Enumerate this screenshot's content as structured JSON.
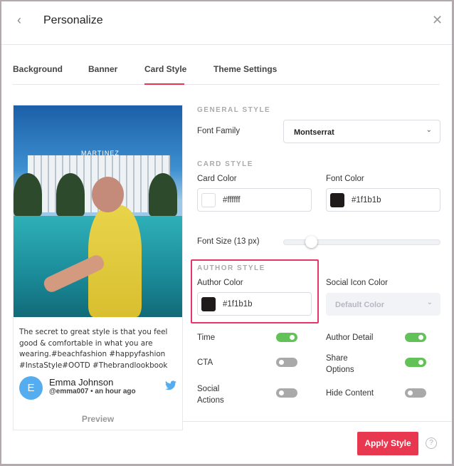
{
  "header": {
    "title": "Personalize",
    "back_icon": "chevron-left",
    "close_icon": "close"
  },
  "tabs": [
    {
      "label": "Background"
    },
    {
      "label": "Banner"
    },
    {
      "label": "Card Style",
      "active": true
    },
    {
      "label": "Theme Settings"
    }
  ],
  "accent_color": "#e8344e",
  "preview": {
    "image_sign": "MARTINEZ",
    "text": "The secret to great style is that you feel good & comfortable in what you are wearing.#beachfashion #happyfashion #InstaStyle#OOTD #Thebrandlookbook",
    "avatar_letter": "E",
    "author": "Emma Johnson",
    "meta": "@emma007 • an hour ago",
    "social_icon": "twitter",
    "label": "Preview"
  },
  "general": {
    "title": "GENERAL STYLE",
    "font_family_label": "Font Family",
    "font_family": "Montserrat"
  },
  "card_style": {
    "title": "CARD STYLE",
    "card_color_label": "Card Color",
    "card_color": "#ffffff",
    "font_color_label": "Font Color",
    "font_color": "#1f1b1b",
    "font_size_label": "Font Size (13 px)",
    "font_size_px": 13
  },
  "author_style": {
    "title": "AUTHOR STYLE",
    "author_color_label": "Author Color",
    "author_color": "#1f1b1b",
    "social_icon_color_label": "Social Icon Color",
    "social_icon_color_placeholder": "Default Color"
  },
  "toggles": [
    {
      "label": "Time",
      "on": true
    },
    {
      "label": "Author Detail",
      "on": true
    },
    {
      "label": "CTA",
      "on": false
    },
    {
      "label": "Share Options",
      "on": true
    },
    {
      "label": "Social Actions",
      "on": false
    },
    {
      "label": "Hide Content",
      "on": false
    }
  ],
  "footer": {
    "apply_label": "Apply Style",
    "help_icon": "?"
  }
}
